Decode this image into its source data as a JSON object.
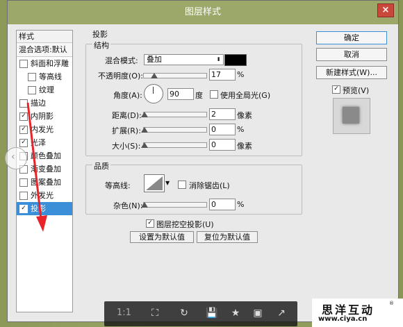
{
  "window": {
    "title": "图层样式",
    "close_label": "×"
  },
  "left_panel": {
    "header": "样式",
    "blend_options": "混合选项:默认",
    "items": [
      {
        "label": "斜面和浮雕",
        "checked": false
      },
      {
        "label": "等高线",
        "checked": false
      },
      {
        "label": "纹理",
        "checked": false
      },
      {
        "label": "描边",
        "checked": false
      },
      {
        "label": "内阴影",
        "checked": true
      },
      {
        "label": "内发光",
        "checked": true
      },
      {
        "label": "光泽",
        "checked": true
      },
      {
        "label": "颜色叠加",
        "checked": false
      },
      {
        "label": "渐变叠加",
        "checked": false
      },
      {
        "label": "图案叠加",
        "checked": false
      },
      {
        "label": "外发光",
        "checked": false
      },
      {
        "label": "投影",
        "checked": true,
        "selected": true
      }
    ],
    "check_mark": "✓"
  },
  "drop_shadow": {
    "section_title": "投影",
    "structure_title": "结构",
    "blend_mode_label": "混合模式:",
    "blend_mode_value": "叠加",
    "color": "#000000",
    "opacity_label": "不透明度(O):",
    "opacity_value": "17",
    "percent": "%",
    "angle_label": "角度(A):",
    "angle_value": "90",
    "degree": "度",
    "global_light_label": "使用全局光(G)",
    "distance_label": "距离(D):",
    "distance_value": "2",
    "pixel": "像素",
    "spread_label": "扩展(R):",
    "spread_value": "0",
    "size_label": "大小(S):",
    "size_value": "0",
    "quality_title": "品质",
    "contour_label": "等高线:",
    "antialias_label": "消除锯齿(L)",
    "noise_label": "杂色(N):",
    "noise_value": "0",
    "knockout_label": "图层挖空投影(U)",
    "knockout_checked": true,
    "set_default": "设置为默认值",
    "reset_default": "复位为默认值"
  },
  "right_panel": {
    "ok": "确定",
    "cancel": "取消",
    "new_style": "新建样式(W)...",
    "preview_label": "预览(V)",
    "preview_checked": true
  },
  "image_toolbar": {
    "ratio": "1:1",
    "icons": [
      "fit-screen-icon",
      "rotate-icon",
      "save-icon",
      "favorite-icon",
      "slideshow-icon",
      "share-icon"
    ]
  },
  "watermark": {
    "title": "思洋互动",
    "url": "www.ciya.cn",
    "reg": "®"
  }
}
